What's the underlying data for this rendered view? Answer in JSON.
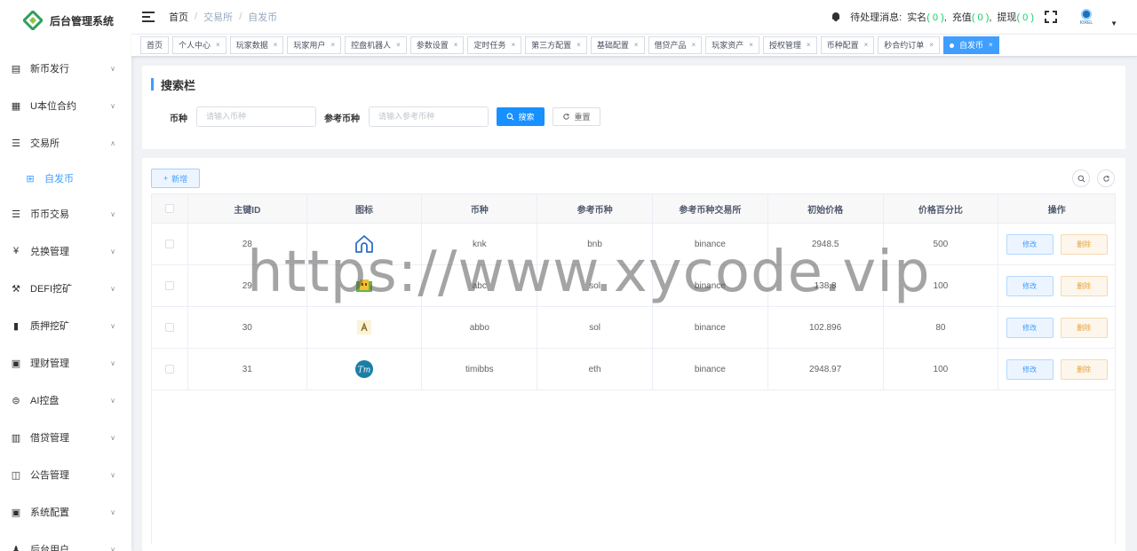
{
  "app": {
    "title": "后台管理系统"
  },
  "sidebar": {
    "items": [
      {
        "label": "新币发行",
        "icon": "document-icon",
        "glyph": "▤",
        "arrow": "∨"
      },
      {
        "label": "U本位合约",
        "icon": "grid-icon",
        "glyph": "▦",
        "arrow": "∨"
      },
      {
        "label": "交易所",
        "icon": "list-icon",
        "glyph": "☰",
        "arrow": "∧"
      },
      {
        "label": "自发币",
        "icon": "table-icon",
        "glyph": "⊞",
        "arrow": ""
      },
      {
        "label": "币币交易",
        "icon": "list-icon",
        "glyph": "☰",
        "arrow": "∨"
      },
      {
        "label": "兑换管理",
        "icon": "yen-icon",
        "glyph": "¥",
        "arrow": "∨"
      },
      {
        "label": "DEFI挖矿",
        "icon": "miner-icon",
        "glyph": "⚒",
        "arrow": "∨"
      },
      {
        "label": "质押挖矿",
        "icon": "bar-chart-icon",
        "glyph": "▮",
        "arrow": "∨"
      },
      {
        "label": "理财管理",
        "icon": "clipboard-icon",
        "glyph": "▣",
        "arrow": "∨"
      },
      {
        "label": "AI控盘",
        "icon": "robot-icon",
        "glyph": "⊜",
        "arrow": "∨"
      },
      {
        "label": "借贷管理",
        "icon": "book-icon",
        "glyph": "▥",
        "arrow": "∨"
      },
      {
        "label": "公告管理",
        "icon": "open-book-icon",
        "glyph": "◫",
        "arrow": "∨"
      },
      {
        "label": "系统配置",
        "icon": "settings-doc-icon",
        "glyph": "▣",
        "arrow": "∨"
      },
      {
        "label": "后台用户",
        "icon": "user-icon",
        "glyph": "♟",
        "arrow": "∨"
      }
    ]
  },
  "header": {
    "breadcrumb": [
      "首页",
      "交易所",
      "自发币"
    ],
    "separator": "/",
    "notice_label": "待处理消息:",
    "notices": [
      {
        "label": "实名",
        "count": "( 0 )"
      },
      {
        "label": "充值",
        "count": "( 0 )"
      },
      {
        "label": "提现",
        "count": "( 0 )"
      }
    ],
    "avatar_text": "KIREL"
  },
  "tags": [
    {
      "label": "首页",
      "closable": false,
      "active": false
    },
    {
      "label": "个人中心",
      "closable": true,
      "active": false
    },
    {
      "label": "玩家数据",
      "closable": true,
      "active": false
    },
    {
      "label": "玩家用户",
      "closable": true,
      "active": false
    },
    {
      "label": "控盘机器人",
      "closable": true,
      "active": false
    },
    {
      "label": "参数设置",
      "closable": true,
      "active": false
    },
    {
      "label": "定时任务",
      "closable": true,
      "active": false
    },
    {
      "label": "第三方配置",
      "closable": true,
      "active": false
    },
    {
      "label": "基础配置",
      "closable": true,
      "active": false
    },
    {
      "label": "借贷产品",
      "closable": true,
      "active": false
    },
    {
      "label": "玩家资产",
      "closable": true,
      "active": false
    },
    {
      "label": "授权管理",
      "closable": true,
      "active": false
    },
    {
      "label": "币种配置",
      "closable": true,
      "active": false
    },
    {
      "label": "秒合约订单",
      "closable": true,
      "active": false
    },
    {
      "label": "自发币",
      "closable": true,
      "active": true
    }
  ],
  "search": {
    "title": "搜索栏",
    "coin_label": "币种",
    "coin_placeholder": "请输入币种",
    "ref_label": "参考币种",
    "ref_placeholder": "请输入参考币种",
    "search_btn": "搜索",
    "reset_btn": "重置"
  },
  "toolbar": {
    "add_btn": "新增"
  },
  "table": {
    "columns": [
      "主键ID",
      "图标",
      "币种",
      "参考币种",
      "参考币种交易所",
      "初始价格",
      "价格百分比",
      "操作"
    ],
    "rows": [
      {
        "id": "28",
        "icon": "house-logo-icon",
        "coin": "knk",
        "ref": "bnb",
        "exchange": "binance",
        "price": "2948.5",
        "percent": "500",
        "edit": "修改",
        "del": "删除"
      },
      {
        "id": "29",
        "icon": "building-logo-icon",
        "coin": "abc",
        "ref": "sol",
        "exchange": "binance",
        "price": "138.8",
        "percent": "100",
        "edit": "修改",
        "del": "删除"
      },
      {
        "id": "30",
        "icon": "a-logo-icon",
        "coin": "abbo",
        "ref": "sol",
        "exchange": "binance",
        "price": "102.896",
        "percent": "80",
        "edit": "修改",
        "del": "删除"
      },
      {
        "id": "31",
        "icon": "tm-logo-icon",
        "coin": "timibbs",
        "ref": "eth",
        "exchange": "binance",
        "price": "2948.97",
        "percent": "100",
        "edit": "修改",
        "del": "删除"
      }
    ]
  },
  "watermark": "https://www.xycode.vip",
  "colors": {
    "primary": "#409eff",
    "success": "#13ce66",
    "warning": "#e6a23c",
    "logo": "#2f9e5f"
  }
}
